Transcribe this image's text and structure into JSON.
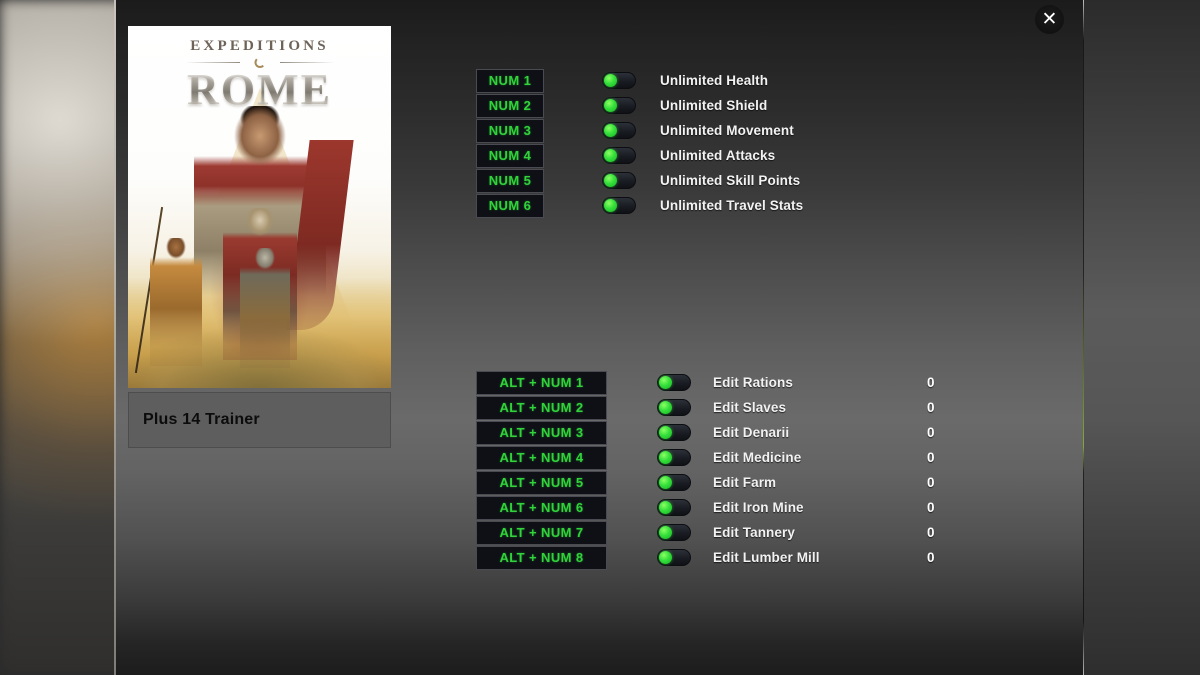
{
  "window": {
    "close_label": "✕"
  },
  "cover": {
    "title_top": "EXPEDITIONS",
    "title_main": "ROME",
    "trainer_label": "Plus 14 Trainer"
  },
  "groups": [
    {
      "id": "cheats",
      "rows": [
        {
          "key": "NUM 1",
          "label": "Unlimited Health",
          "toggle": "on"
        },
        {
          "key": "NUM 2",
          "label": "Unlimited Shield",
          "toggle": "on"
        },
        {
          "key": "NUM 3",
          "label": "Unlimited Movement",
          "toggle": "on"
        },
        {
          "key": "NUM 4",
          "label": "Unlimited Attacks",
          "toggle": "on"
        },
        {
          "key": "NUM 5",
          "label": "Unlimited Skill Points",
          "toggle": "on"
        },
        {
          "key": "NUM 6",
          "label": "Unlimited Travel Stats",
          "toggle": "on"
        }
      ]
    },
    {
      "id": "editors",
      "rows": [
        {
          "key": "ALT + NUM 1",
          "label": "Edit Rations",
          "toggle": "on",
          "value": "0"
        },
        {
          "key": "ALT + NUM 2",
          "label": "Edit Slaves",
          "toggle": "on",
          "value": "0"
        },
        {
          "key": "ALT + NUM 3",
          "label": "Edit Denarii",
          "toggle": "on",
          "value": "0"
        },
        {
          "key": "ALT + NUM 4",
          "label": "Edit Medicine",
          "toggle": "on",
          "value": "0"
        },
        {
          "key": "ALT + NUM 5",
          "label": "Edit Farm",
          "toggle": "on",
          "value": "0"
        },
        {
          "key": "ALT + NUM 6",
          "label": "Edit Iron Mine",
          "toggle": "on",
          "value": "0"
        },
        {
          "key": "ALT + NUM 7",
          "label": "Edit Tannery",
          "toggle": "on",
          "value": "0"
        },
        {
          "key": "ALT + NUM 8",
          "label": "Edit Lumber Mill",
          "toggle": "on",
          "value": "0"
        }
      ]
    }
  ],
  "colors": {
    "key_text": "#31d23a",
    "toggle_on": "#35e03b",
    "label_text": "#f2f2f2",
    "plus_bar": "#5e5e5e"
  }
}
